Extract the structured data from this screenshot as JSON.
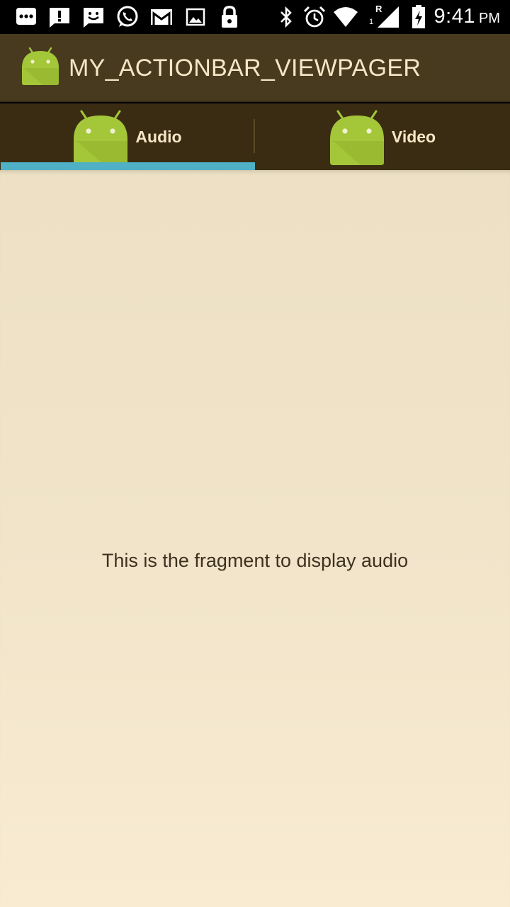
{
  "status_bar": {
    "left_icons": [
      "chat-bubble-icon",
      "alert-message-icon",
      "feedback-icon",
      "whatsapp-icon",
      "gmail-icon",
      "gallery-icon",
      "lock-icon"
    ],
    "right_icons": [
      "bluetooth-icon",
      "alarm-icon",
      "wifi-icon",
      "signal-icon",
      "battery-charging-icon"
    ],
    "signal_roaming_label": "R",
    "signal_sim_label": "1",
    "time": "9:41",
    "ampm": "PM"
  },
  "action_bar": {
    "title": "MY_ACTIONBAR_VIEWPAGER",
    "background": "#483a1f",
    "title_color": "#f5e6c6"
  },
  "tabs": [
    {
      "label": "Audio",
      "icon": "android-robot-icon",
      "selected": true
    },
    {
      "label": "Video",
      "icon": "android-robot-icon",
      "selected": false
    }
  ],
  "tab_indicator_color": "#4fb0c6",
  "content": {
    "message": "This is the fragment to display audio"
  }
}
